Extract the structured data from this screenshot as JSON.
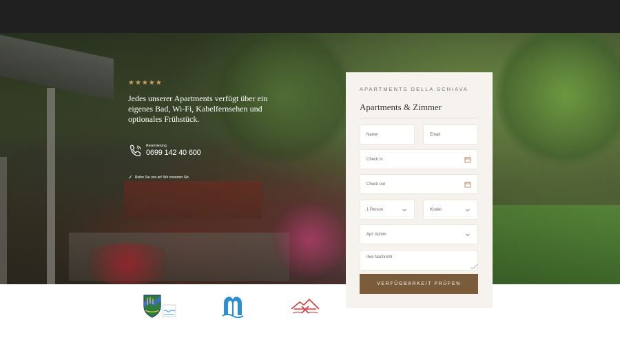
{
  "hero": {
    "stars": "★★★★★",
    "intro_text": "Jedes unserer Apartments verfügt über ein eigenes Bad, Wi-Fi, Kabelfernsehen und optionales Frühstück.",
    "phone_label": "Reservierung",
    "phone_number": "0699 142 40 600",
    "call_note": "Rufen Sie uns an! Wir erwarten Sie."
  },
  "booking": {
    "kicker": "APARTMENTS DELLA SCHIAVA",
    "title": "Apartments & Zimmer",
    "name_placeholder": "Name",
    "email_placeholder": "Email",
    "checkin_placeholder": "Check In",
    "checkout_placeholder": "Check out",
    "persons_value": "1 Person",
    "kinder_value": "Kinder",
    "apartment_value": "Apt. Achim",
    "message_placeholder": "Ihre Nachricht",
    "submit_label": "VERFÜGBARKEIT PRÜFEN"
  },
  "icons": {
    "phone": "phone-icon",
    "calendar": "calendar-icon",
    "chevron": "chevron-down-icon",
    "check": "check-icon"
  },
  "colors": {
    "topbar": "#202020",
    "accent_gold": "#c9a25d",
    "button": "#7a5c3b",
    "panel": "#f6f3ee"
  }
}
